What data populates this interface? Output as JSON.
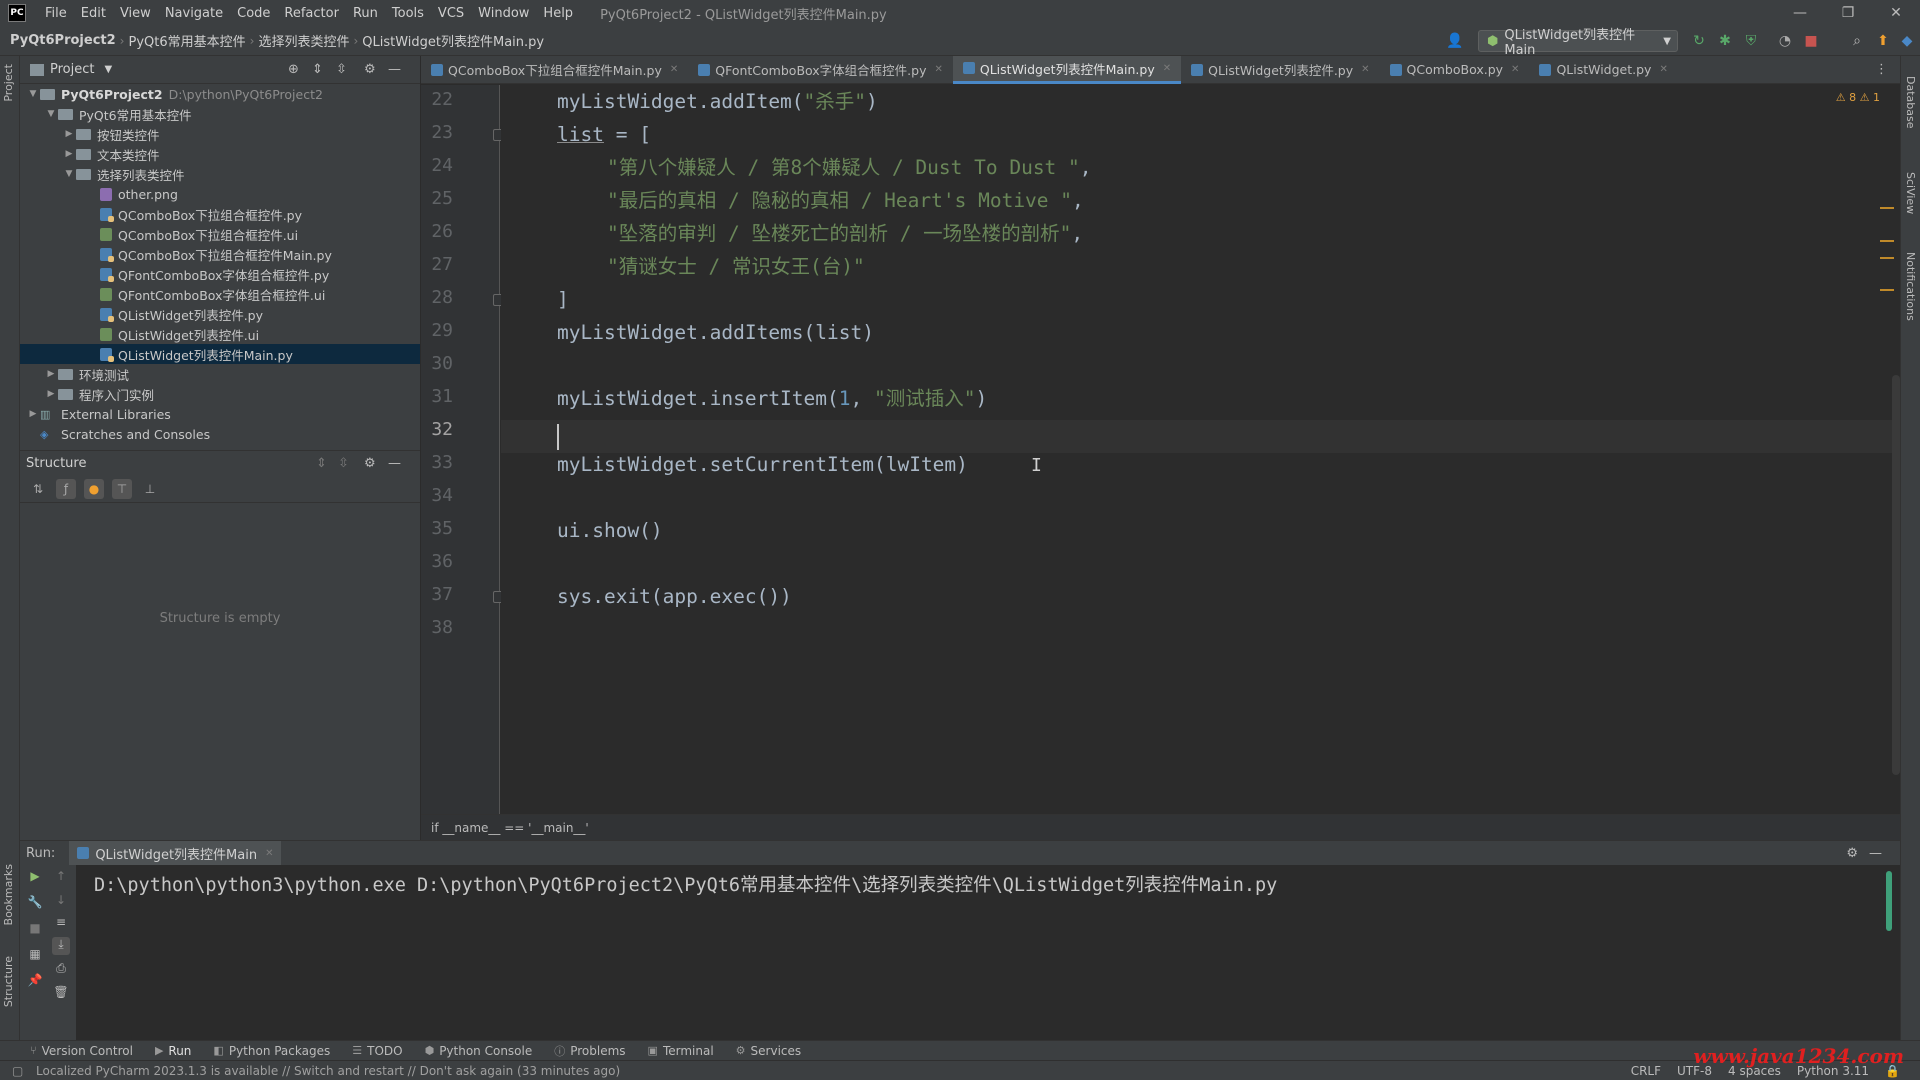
{
  "menubar": {
    "logo": "PC",
    "items": [
      "File",
      "Edit",
      "View",
      "Navigate",
      "Code",
      "Refactor",
      "Run",
      "Tools",
      "VCS",
      "Window",
      "Help"
    ],
    "title": "PyQt6Project2 - QListWidget列表控件Main.py",
    "win_minimize": "—",
    "win_restore": "❐",
    "win_close": "✕"
  },
  "navbar": {
    "crumbs": [
      "PyQt6Project2",
      "PyQt6常用基本控件",
      "选择列表类控件",
      "QListWidget列表控件Main.py"
    ],
    "run_config": "QListWidget列表控件Main"
  },
  "left_stripe": {
    "project": "Project",
    "bookmarks": "Bookmarks",
    "structure": "Structure"
  },
  "right_stripe": {
    "database": "Database",
    "sciview": "SciView",
    "notifications": "Notifications"
  },
  "project_panel": {
    "title": "Project",
    "items": [
      {
        "label": "PyQt6Project2",
        "path": "D:\\python\\PyQt6Project2"
      },
      {
        "label": "PyQt6常用基本控件"
      },
      {
        "label": "按钮类控件"
      },
      {
        "label": "文本类控件"
      },
      {
        "label": "选择列表类控件"
      },
      {
        "label": "other.png"
      },
      {
        "label": "QComboBox下拉组合框控件.py"
      },
      {
        "label": "QComboBox下拉组合框控件.ui"
      },
      {
        "label": "QComboBox下拉组合框控件Main.py"
      },
      {
        "label": "QFontComboBox字体组合框控件.py"
      },
      {
        "label": "QFontComboBox字体组合框控件.ui"
      },
      {
        "label": "QListWidget列表控件.py"
      },
      {
        "label": "QListWidget列表控件.ui"
      },
      {
        "label": "QListWidget列表控件Main.py"
      },
      {
        "label": "环境测试"
      },
      {
        "label": "程序入门实例"
      },
      {
        "label": "External Libraries"
      },
      {
        "label": "Scratches and Consoles"
      }
    ]
  },
  "structure_panel": {
    "title": "Structure",
    "empty_text": "Structure is empty"
  },
  "editor_tabs": [
    {
      "label": "QComboBox下拉组合框控件Main.py",
      "active": false
    },
    {
      "label": "QFontComboBox字体组合框控件.py",
      "active": false
    },
    {
      "label": "QListWidget列表控件Main.py",
      "active": true
    },
    {
      "label": "QListWidget列表控件.py",
      "active": false
    },
    {
      "label": "QComboBox.py",
      "active": false
    },
    {
      "label": "QListWidget.py",
      "active": false
    }
  ],
  "editor": {
    "line_numbers": [
      "22",
      "23",
      "24",
      "25",
      "26",
      "27",
      "28",
      "29",
      "30",
      "31",
      "32",
      "33",
      "34",
      "35",
      "36",
      "37",
      "38"
    ],
    "current_line": "32",
    "warnings": "⚠ 8  ⚠ 1",
    "code": {
      "l22_a": "myListWidget.addItem(",
      "l22_s": "\"杀手\"",
      "l22_b": ")",
      "l23_a": "list",
      "l23_b": " = [",
      "l24_s": "\"第八个嫌疑人 / 第8个嫌疑人 / Dust To Dust \"",
      "l24_b": ",",
      "l25_s": "\"最后的真相 / 隐秘的真相 / Heart's Motive \"",
      "l25_b": ",",
      "l26_s": "\"坠落的审判 / 坠楼死亡的剖析 / 一场坠楼的剖析\"",
      "l26_b": ",",
      "l27_s": "\"猜谜女士 / 常识女王(台)\"",
      "l28": "]",
      "l29": "myListWidget.addItems(list)",
      "l31_a": "myListWidget.insertItem(",
      "l31_n": "1",
      "l31_b": ", ",
      "l31_s": "\"测试插入\"",
      "l31_c": ")",
      "l33": "myListWidget.setCurrentItem(lwItem)",
      "l35": "ui.show()",
      "l37": "sys.exit(app.exec())"
    },
    "bottom_breadcrumb": "if __name__ == '__main__'"
  },
  "run_panel": {
    "label": "Run:",
    "tab": "QListWidget列表控件Main",
    "console_line": "D:\\python\\python3\\python.exe D:\\python\\PyQt6Project2\\PyQt6常用基本控件\\选择列表类控件\\QListWidget列表控件Main.py"
  },
  "bottom_toolbar": [
    "Version Control",
    "Run",
    "Python Packages",
    "TODO",
    "Python Console",
    "Problems",
    "Terminal",
    "Services"
  ],
  "statusbar": {
    "message": "Localized PyCharm 2023.1.3 is available // Switch and restart // Don't ask again (33 minutes ago)",
    "line_sep": "CRLF",
    "encoding": "UTF-8",
    "indent": "4 spaces",
    "interpreter": "Python 3.11"
  },
  "watermark": "www.java1234.com"
}
